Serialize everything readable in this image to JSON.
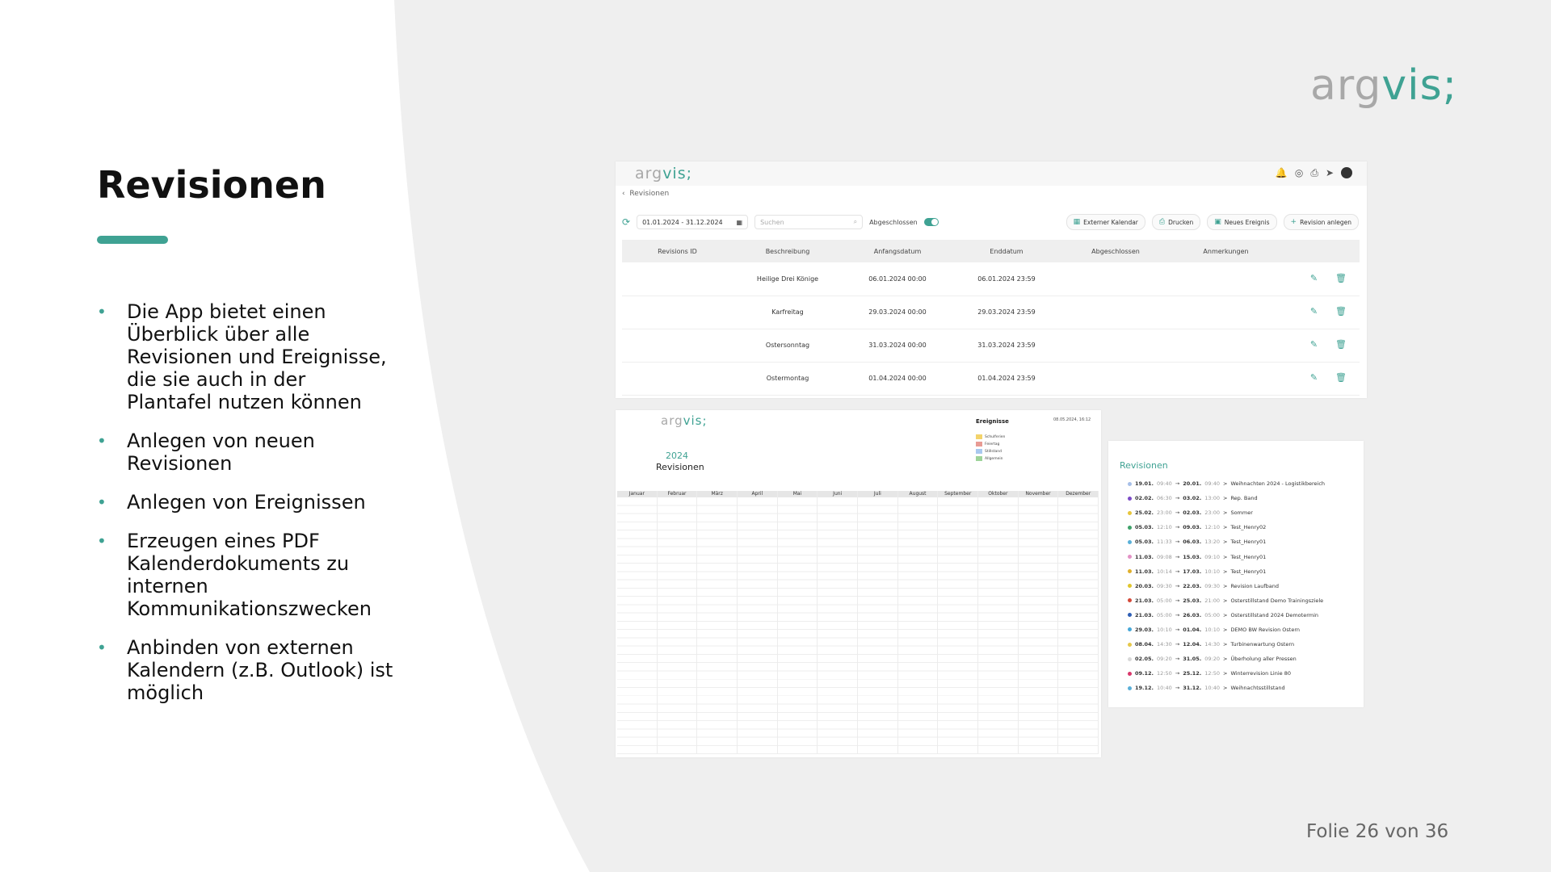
{
  "slide": {
    "logo": {
      "part1": "arg",
      "part2": "vis;"
    },
    "title": "Revisionen",
    "bullets": [
      "Die App bietet einen Überblick über alle Revisionen und Ereignisse, die sie auch in der Plantafel nutzen können",
      "Anlegen von neuen Revisionen",
      "Anlegen von Ereignissen",
      "Erzeugen eines PDF Kalenderdokuments zu internen Kommunikationszwecken",
      "Anbinden von externen Kalendern (z.B. Outlook) ist möglich"
    ],
    "footer": "Folie 26 von 36",
    "accent_color": "#3fa293"
  },
  "app": {
    "logo": {
      "part1": "arg",
      "part2": "vis;"
    },
    "breadcrumb": "Revisionen",
    "date_range": "01.01.2024 - 31.12.2024",
    "search_placeholder": "Suchen",
    "toggle_label": "Abgeschlossen",
    "buttons": {
      "external_calendar": "Externer Kalendar",
      "print": "Drucken",
      "new_event": "Neues Ereignis",
      "new_revision": "Revision anlegen"
    },
    "columns": [
      "Revisions ID",
      "Beschreibung",
      "Anfangsdatum",
      "Enddatum",
      "Abgeschlossen",
      "Anmerkungen"
    ],
    "rows": [
      {
        "description": "Heilige Drei Könige",
        "start": "06.01.2024 00:00",
        "end": "06.01.2024 23:59"
      },
      {
        "description": "Karfreitag",
        "start": "29.03.2024 00:00",
        "end": "29.03.2024 23:59"
      },
      {
        "description": "Ostersonntag",
        "start": "31.03.2024 00:00",
        "end": "31.03.2024 23:59"
      },
      {
        "description": "Ostermontag",
        "start": "01.04.2024 00:00",
        "end": "01.04.2024 23:59"
      }
    ]
  },
  "calendar_pdf": {
    "logo": {
      "part1": "arg",
      "part2": "vis;"
    },
    "year": "2024",
    "subtitle": "Revisionen",
    "legend_title": "Ereignisse",
    "print_date": "08.05.2024, 16:12",
    "legend": [
      {
        "label": "Schulferien",
        "color": "#f3d36b"
      },
      {
        "label": "Feiertag",
        "color": "#e89b94"
      },
      {
        "label": "Stillstand",
        "color": "#a9c9ef"
      },
      {
        "label": "Allgemein",
        "color": "#9ed39a"
      }
    ],
    "months": [
      "Januar",
      "Februar",
      "März",
      "April",
      "Mai",
      "Juni",
      "Juli",
      "August",
      "September",
      "Oktober",
      "November",
      "Dezember"
    ]
  },
  "revision_list": {
    "title": "Revisionen",
    "items": [
      {
        "start": "19.01.",
        "start_time": "09:40",
        "end": "20.01.",
        "end_time": "09:40",
        "text": "Weihnachten 2024 - Logistikbereich",
        "color": "#a7c0e8"
      },
      {
        "start": "02.02.",
        "start_time": "06:30",
        "end": "03.02.",
        "end_time": "13:00",
        "text": "Rep. Band",
        "color": "#7c4bc7"
      },
      {
        "start": "25.02.",
        "start_time": "23:00",
        "end": "02.03.",
        "end_time": "23:00",
        "text": "Sommer",
        "color": "#e7c63c"
      },
      {
        "start": "05.03.",
        "start_time": "12:10",
        "end": "09.03.",
        "end_time": "12:10",
        "text": "Test_Henry02",
        "color": "#3fa26a"
      },
      {
        "start": "05.03.",
        "start_time": "11:33",
        "end": "06.03.",
        "end_time": "13:20",
        "text": "Test_Henry01",
        "color": "#5ab0d8"
      },
      {
        "start": "11.03.",
        "start_time": "09:08",
        "end": "15.03.",
        "end_time": "09:10",
        "text": "Test_Henry01",
        "color": "#e392c6"
      },
      {
        "start": "11.03.",
        "start_time": "10:14",
        "end": "17.03.",
        "end_time": "10:10",
        "text": "Test_Henry01",
        "color": "#e0b02d"
      },
      {
        "start": "20.03.",
        "start_time": "09:30",
        "end": "22.03.",
        "end_time": "09:30",
        "text": "Revision Laufband",
        "color": "#e0c62d"
      },
      {
        "start": "21.03.",
        "start_time": "05:00",
        "end": "25.03.",
        "end_time": "21:00",
        "text": "Osterstillstand Demo Trainingsziele",
        "color": "#d44a3a"
      },
      {
        "start": "21.03.",
        "start_time": "05:00",
        "end": "26.03.",
        "end_time": "05:00",
        "text": "Osterstillstand 2024 Demotermin",
        "color": "#2f5fb5"
      },
      {
        "start": "29.03.",
        "start_time": "10:10",
        "end": "01.04.",
        "end_time": "10:10",
        "text": "DEMO BW Revision Ostern",
        "color": "#47a8d8"
      },
      {
        "start": "08.04.",
        "start_time": "14:30",
        "end": "12.04.",
        "end_time": "14:30",
        "text": "Turbinenwartung Ostern",
        "color": "#e6c84a"
      },
      {
        "start": "02.05.",
        "start_time": "09:20",
        "end": "31.05.",
        "end_time": "09:20",
        "text": "Überholung aller Pressen",
        "color": "#d8d8d8"
      },
      {
        "start": "09.12.",
        "start_time": "12:50",
        "end": "25.12.",
        "end_time": "12:50",
        "text": "Winterrevision Linie 80",
        "color": "#d9376b"
      },
      {
        "start": "19.12.",
        "start_time": "10:40",
        "end": "31.12.",
        "end_time": "10:40",
        "text": "Weihnachtsstillstand",
        "color": "#5ab0d8"
      }
    ]
  }
}
